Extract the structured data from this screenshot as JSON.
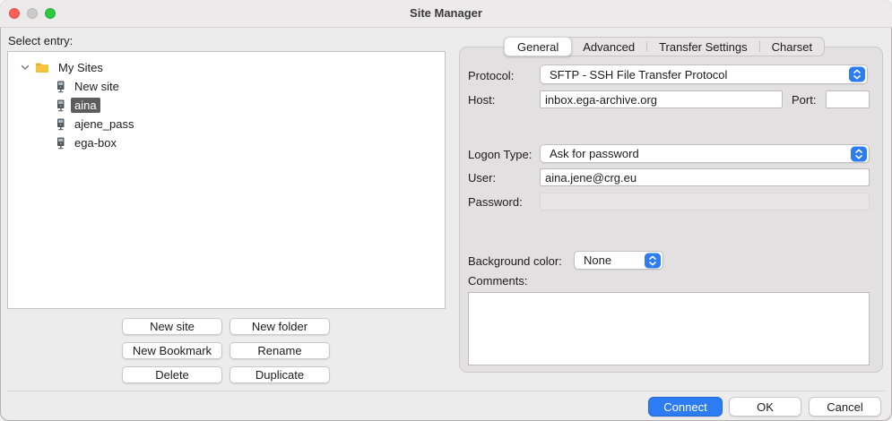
{
  "window": {
    "title": "Site Manager"
  },
  "titlebar": {
    "buttons": [
      "close",
      "minimize",
      "zoom"
    ]
  },
  "sidebar": {
    "select_entry_label": "Select entry:",
    "tree": {
      "root": {
        "label": "My Sites",
        "expanded": true,
        "icon": "folder-icon"
      },
      "items": [
        {
          "label": "New site",
          "icon": "server-icon",
          "selected": false
        },
        {
          "label": "aina",
          "icon": "server-icon",
          "selected": true
        },
        {
          "label": "ajene_pass",
          "icon": "server-icon",
          "selected": false
        },
        {
          "label": "ega-box",
          "icon": "server-icon",
          "selected": false
        }
      ]
    },
    "buttons": [
      {
        "label": "New site"
      },
      {
        "label": "New folder"
      },
      {
        "label": "New Bookmark"
      },
      {
        "label": "Rename"
      },
      {
        "label": "Delete"
      },
      {
        "label": "Duplicate"
      }
    ]
  },
  "tabs": [
    {
      "label": "General",
      "active": true
    },
    {
      "label": "Advanced",
      "active": false
    },
    {
      "label": "Transfer Settings",
      "active": false
    },
    {
      "label": "Charset",
      "active": false
    }
  ],
  "form": {
    "protocol": {
      "label": "Protocol:",
      "value": "SFTP - SSH File Transfer Protocol"
    },
    "host": {
      "label": "Host:",
      "value": "inbox.ega-archive.org"
    },
    "port": {
      "label": "Port:",
      "value": ""
    },
    "logon_type": {
      "label": "Logon Type:",
      "value": "Ask for password"
    },
    "user": {
      "label": "User:",
      "value": "aina.jene@crg.eu"
    },
    "password": {
      "label": "Password:",
      "value": "",
      "disabled": true
    },
    "background_color": {
      "label": "Background color:",
      "value": "None"
    },
    "comments": {
      "label": "Comments:",
      "value": ""
    }
  },
  "footer": {
    "connect_label": "Connect",
    "ok_label": "OK",
    "cancel_label": "Cancel"
  },
  "colors": {
    "accent_blue": "#2D7CF3",
    "selection_gray": "#5D5D5D",
    "folder_yellow": "#F5B915",
    "traffic_red": "#FF5F57",
    "traffic_gray": "#CBCBC9",
    "traffic_green": "#2BC840"
  }
}
